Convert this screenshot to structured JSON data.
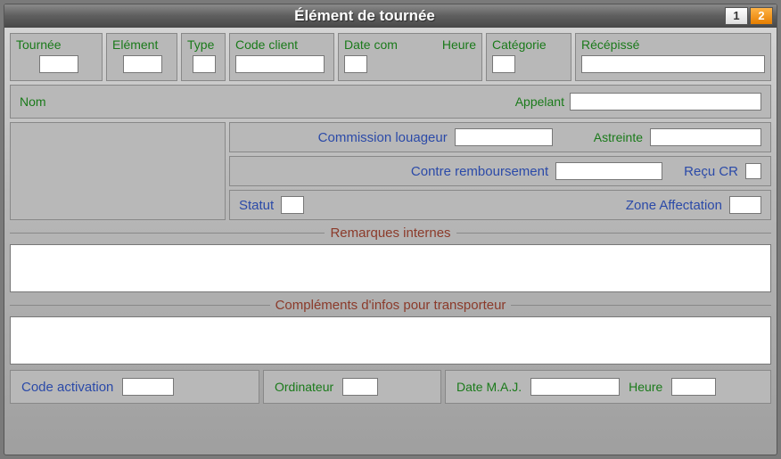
{
  "window": {
    "title": "Élément de tournée",
    "pager": {
      "page1": "1",
      "page2": "2",
      "active": 2
    }
  },
  "header": {
    "tournee": {
      "label": "Tournée",
      "value": ""
    },
    "element": {
      "label": "Elément",
      "value": ""
    },
    "type": {
      "label": "Type",
      "value": ""
    },
    "code_client": {
      "label": "Code client",
      "value": ""
    },
    "date_com": {
      "label": "Date com",
      "value": ""
    },
    "heure": {
      "label": "Heure",
      "value": ""
    },
    "categorie": {
      "label": "Catégorie",
      "value": ""
    },
    "recepisse": {
      "label": "Récépissé",
      "value": ""
    }
  },
  "middle": {
    "nom": {
      "label": "Nom"
    },
    "appelant": {
      "label": "Appelant",
      "value": ""
    },
    "commission": {
      "label": "Commission louageur",
      "value": ""
    },
    "astreinte": {
      "label": "Astreinte",
      "value": ""
    },
    "contre_remb": {
      "label": "Contre remboursement",
      "value": ""
    },
    "recu_cr": {
      "label": "Reçu CR",
      "value": ""
    },
    "statut": {
      "label": "Statut",
      "value": ""
    },
    "zone_affect": {
      "label": "Zone Affectation",
      "value": ""
    }
  },
  "sections": {
    "remarques": {
      "title": "Remarques internes",
      "value": ""
    },
    "complements": {
      "title": "Compléments d'infos pour transporteur",
      "value": ""
    }
  },
  "footer": {
    "code_activation": {
      "label": "Code activation",
      "value": ""
    },
    "ordinateur": {
      "label": "Ordinateur",
      "value": ""
    },
    "date_maj": {
      "label": "Date M.A.J.",
      "value": ""
    },
    "heure": {
      "label": "Heure",
      "value": ""
    }
  }
}
